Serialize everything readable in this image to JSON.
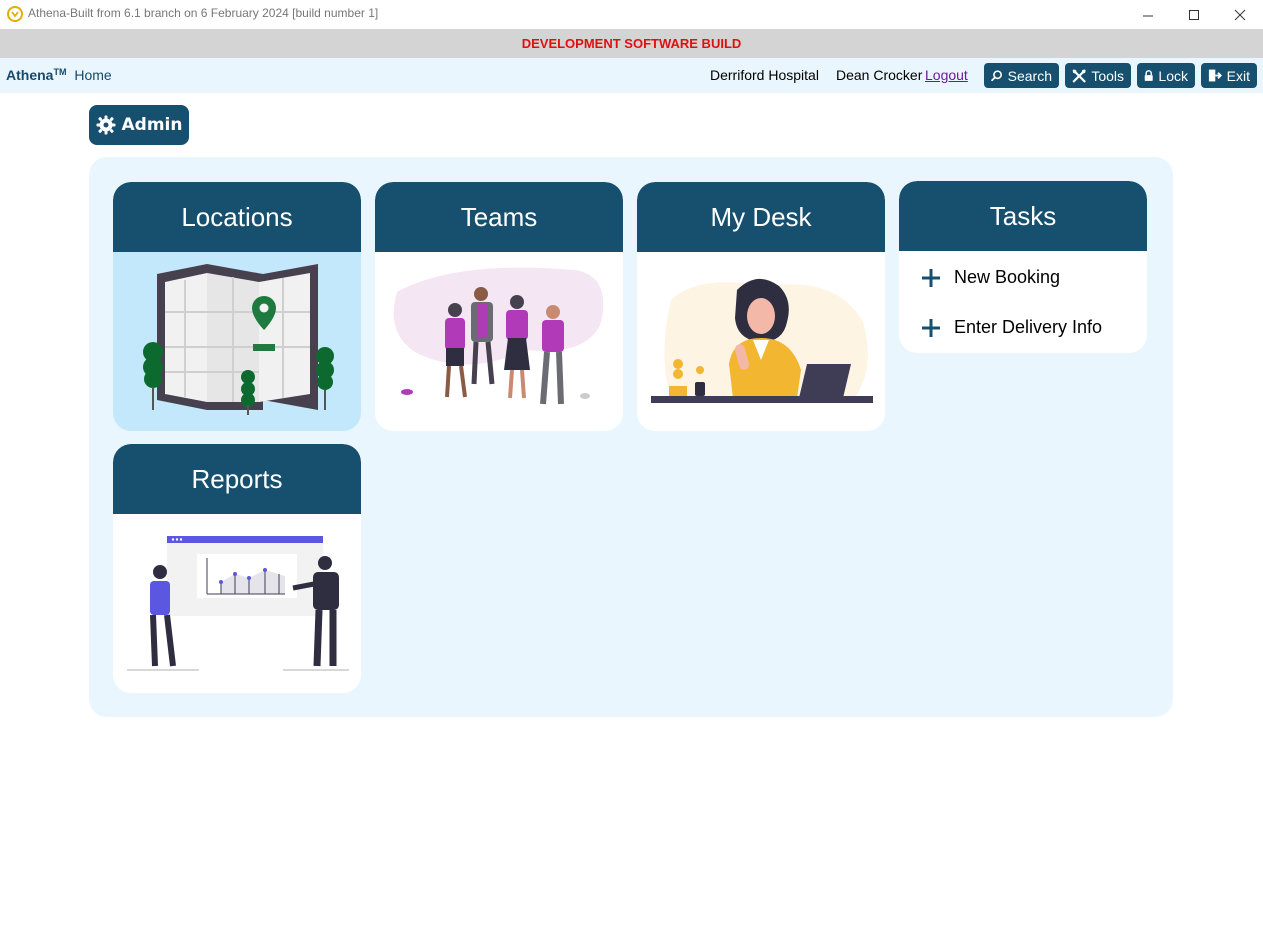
{
  "window": {
    "title": "Athena-Built from 6.1 branch on 6 February 2024 [build number 1]"
  },
  "banner": {
    "text": "DEVELOPMENT SOFTWARE BUILD"
  },
  "nav": {
    "brand": "Athena",
    "trademark": "TM",
    "home": "Home",
    "site": "Derriford Hospital",
    "user": "Dean Crocker",
    "logout": "Logout",
    "buttons": {
      "search": "Search",
      "tools": "Tools",
      "lock": "Lock",
      "exit": "Exit"
    }
  },
  "admin": {
    "label": "Admin"
  },
  "tiles": {
    "locations": {
      "title": "Locations"
    },
    "teams": {
      "title": "Teams"
    },
    "mydesk": {
      "title": "My Desk"
    },
    "tasks": {
      "title": "Tasks",
      "items": [
        {
          "label": "New Booking"
        },
        {
          "label": "Enter Delivery Info"
        }
      ]
    },
    "reports": {
      "title": "Reports"
    }
  },
  "colors": {
    "primary": "#16506e",
    "panel": "#eaf6fd",
    "banner_text": "#e01010",
    "accent_purple": "#b03ab8",
    "accent_yellow": "#f2b630"
  }
}
